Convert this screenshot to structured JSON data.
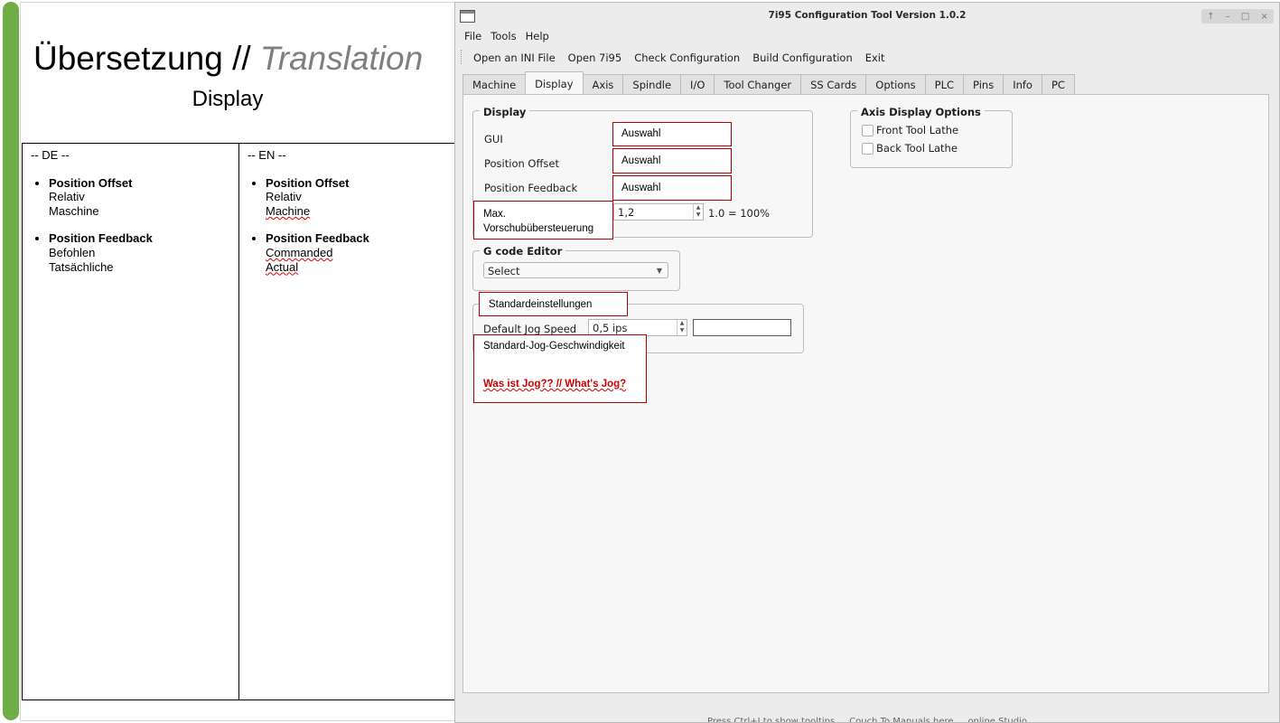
{
  "slide": {
    "title_de": "Übersetzung //",
    "title_en": "Translation",
    "subtitle": "Display",
    "de": {
      "header": "-- DE --",
      "groups": [
        {
          "bold": "Position Offset",
          "items": [
            "Relativ",
            "Maschine"
          ]
        },
        {
          "bold": "Position Feedback",
          "items": [
            "Befohlen",
            "Tatsächliche"
          ]
        }
      ]
    },
    "en": {
      "header": "-- EN --",
      "groups": [
        {
          "bold": "Position Offset",
          "items": [
            "Relativ",
            "Machine"
          ]
        },
        {
          "bold": "Position Feedback",
          "items": [
            "Commanded",
            "Actual"
          ]
        }
      ]
    },
    "accent_color": "#6fad46"
  },
  "window": {
    "title": "7i95 Configuration Tool Version 1.0.2",
    "controls": [
      "↑",
      "–",
      "□",
      "×"
    ],
    "menu": [
      "File",
      "Tools",
      "Help"
    ],
    "toolbar": [
      "Open an INI File",
      "Open 7i95",
      "Check Configuration",
      "Build Configuration",
      "Exit"
    ],
    "tabs": [
      "Machine",
      "Display",
      "Axis",
      "Spindle",
      "I/O",
      "Tool Changer",
      "SS Cards",
      "Options",
      "PLC",
      "Pins",
      "Info",
      "PC"
    ],
    "active_tab": "Display",
    "display_group": {
      "label": "Display",
      "gui_label": "GUI",
      "pos_offset_label": "Position Offset",
      "pos_feedback_label": "Position Feedback",
      "feed_override_value": "1,2",
      "feed_override_hint": "1.0 = 100%"
    },
    "axis_display": {
      "label": "Axis Display Options",
      "options": [
        "Front Tool Lathe",
        "Back Tool Lathe"
      ]
    },
    "gcode": {
      "label": "G code Editor",
      "select_value": "Select"
    },
    "defaults": {
      "jog_label": "Default Jog Speed",
      "jog_value": "0,5 ips",
      "jog_extra": ""
    },
    "status_text": "Press Ctrl+I to show tooltips ... Couch To Manuals here ... online Studio"
  },
  "annotations": {
    "gui": "Auswahl",
    "pos_offset": "Auswahl",
    "pos_feedback": "Auswahl",
    "max_line1": "Max.",
    "max_line2": "Vorschubübersteuerung",
    "defaults_title": "Standardeinstellungen",
    "jog_de": "Standard-Jog-Geschwindigkeit",
    "jog_q": "Was ist Jog?? // What's Jog?",
    "border_color": "#c00000"
  }
}
